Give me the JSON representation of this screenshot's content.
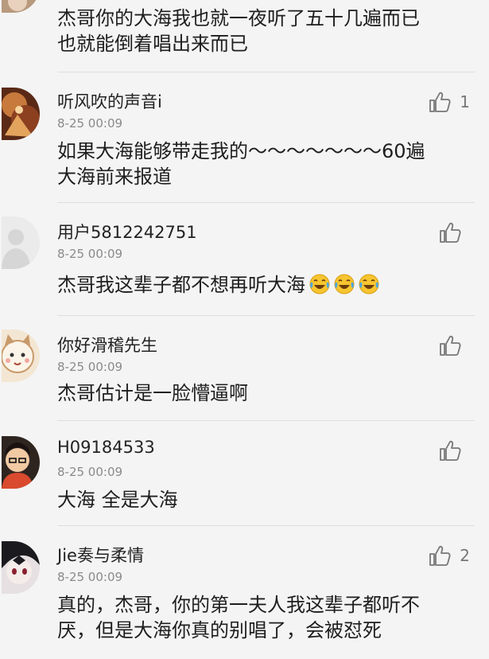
{
  "top_comment": {
    "text": "杰哥你的大海我也就一夜听了五十几遍而已\n也就能倒着唱出来而已"
  },
  "comments": [
    {
      "username": "听风吹的声音i",
      "time": "8-25 00:09",
      "text": "如果大海能够带走我的～～～～～～～60遍\n大海前来报道",
      "likes": "1",
      "avatar": "anime-character-avatar"
    },
    {
      "username": "用户5812242751",
      "time": "8-25 00:09",
      "text": "杰哥我这辈子都不想再听大海",
      "emoji": [
        "laugh-cry-emoji",
        "laugh-cry-emoji",
        "laugh-cry-emoji"
      ],
      "likes": "",
      "avatar": "default-avatar"
    },
    {
      "username": "你好滑稽先生",
      "time": "8-25 00:09",
      "text": "杰哥估计是一脸懵逼啊",
      "likes": "",
      "avatar": "cartoon-cat-avatar"
    },
    {
      "username": "H09184533",
      "time": "8-25 00:09",
      "text": "大海 全是大海",
      "likes": "",
      "avatar": "cartoon-boy-avatar"
    },
    {
      "username": "Jie奏与柔情",
      "time": "8-25 00:09",
      "text": "真的，杰哥，你的第一夫人我这辈子都听不\n厌，但是大海你真的别唱了，会被怼死",
      "likes": "2",
      "avatar": "anime-face-avatar"
    }
  ],
  "colors": {
    "background": "#f4f4f4",
    "divider": "#dedede",
    "time_text": "#8a8a8a",
    "like_icon": "#777777"
  }
}
